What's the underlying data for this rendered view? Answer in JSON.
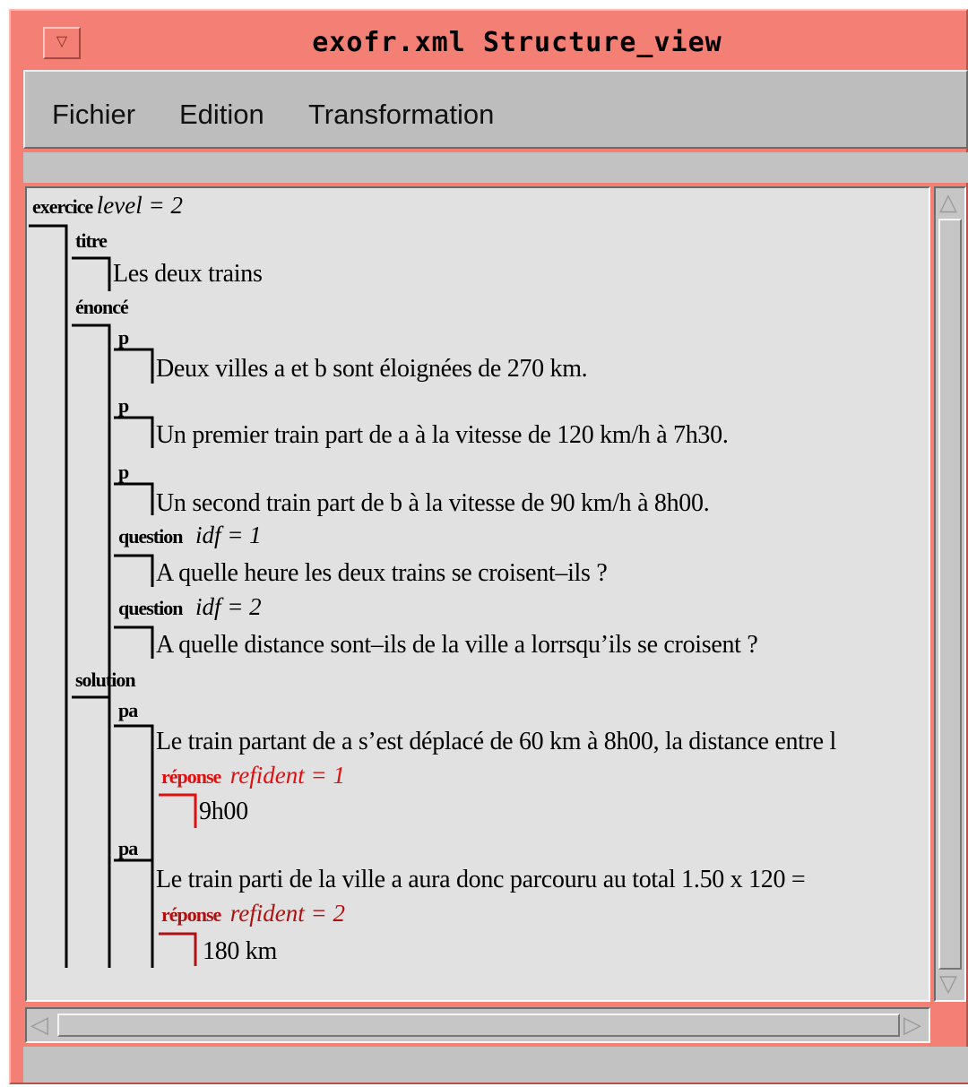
{
  "window": {
    "title": "exofr.xml  Structure_view",
    "menu_icon": "triangle-down-icon"
  },
  "menubar": {
    "items": [
      "Fichier",
      "Edition",
      "Transformation"
    ]
  },
  "tree": {
    "exercice": {
      "tag": "exercice",
      "attr": "level = 2"
    },
    "titre": {
      "tag": "titre",
      "text": "Les deux trains"
    },
    "enonce": {
      "tag": "énoncé"
    },
    "p1": {
      "tag": "p",
      "text": "Deux villes a et b sont éloignées de 270 km."
    },
    "p2": {
      "tag": "p",
      "text": "Un premier train part de a à la vitesse de 120 km/h à 7h30."
    },
    "p3": {
      "tag": "p",
      "text": "Un second train part de b à la vitesse de 90 km/h à 8h00."
    },
    "q1": {
      "tag": "question",
      "attr": "idf = 1",
      "text": "A quelle heure les deux trains se croisent–ils ?"
    },
    "q2": {
      "tag": "question",
      "attr": "idf = 2",
      "text": "A quelle distance sont–ils de la ville a lorrsqu’ils se croisent ?"
    },
    "solution": {
      "tag": "solution"
    },
    "pa1": {
      "tag": "pa",
      "text": "Le train partant de a s’est déplacé de 60 km à 8h00, la distance entre l",
      "reponse_tag": "réponse",
      "reponse_attr": "refident = 1",
      "reponse_text": "9h00"
    },
    "pa2": {
      "tag": "pa",
      "text": "Le train parti de la ville a aura donc parcouru au total 1.50 x 120 =",
      "reponse_tag": "réponse",
      "reponse_attr": "refident = 2",
      "reponse_text": "180 km"
    }
  },
  "colors": {
    "titlebar": "#f47f74",
    "panel": "#e1e1e1",
    "reponse_active": "#e01010",
    "reponse": "#b01010"
  }
}
